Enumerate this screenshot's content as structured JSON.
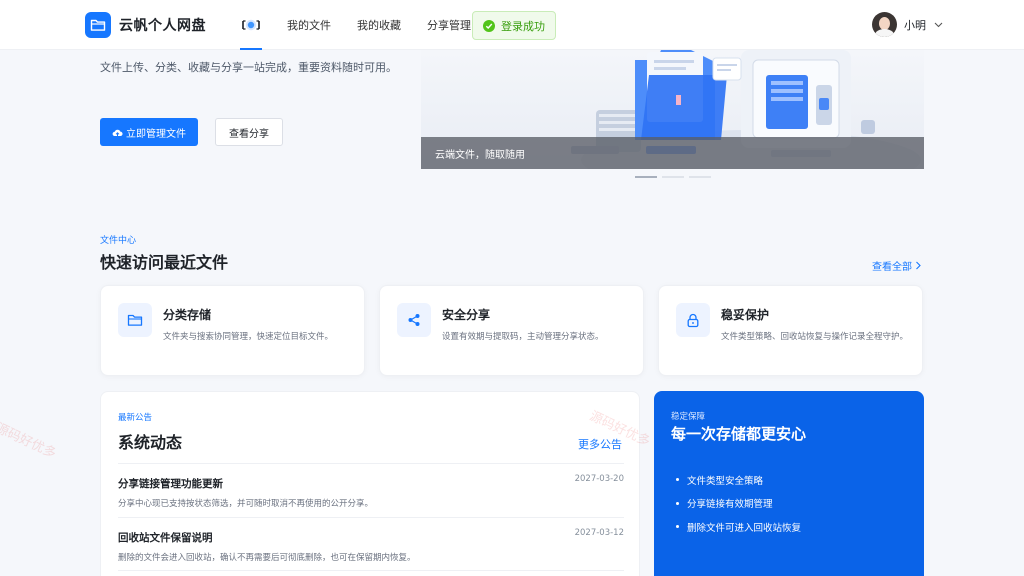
{
  "header": {
    "logo_text": "云帆个人网盘",
    "nav": [
      {
        "label": "我的文件"
      },
      {
        "label": "我的收藏"
      },
      {
        "label": "分享管理"
      }
    ],
    "toast": "登录成功",
    "user_name": "小明"
  },
  "hero": {
    "description": "文件上传、分类、收藏与分享一站完成，重要资料随时可用。",
    "primary_button": "立即管理文件",
    "secondary_button": "查看分享",
    "banner_caption": "云端文件，随取随用",
    "carousel": {
      "count": 3,
      "active_index": 0
    }
  },
  "recent": {
    "tag": "文件中心",
    "title": "快速访问最近文件",
    "view_all": "查看全部",
    "cards": [
      {
        "icon": "folder-icon",
        "title": "分类存储",
        "desc": "文件夹与搜索协同管理，快速定位目标文件。"
      },
      {
        "icon": "share-icon",
        "title": "安全分享",
        "desc": "设置有效期与提取码，主动管理分享状态。"
      },
      {
        "icon": "lock-icon",
        "title": "稳妥保护",
        "desc": "文件类型策略、回收站恢复与操作记录全程守护。"
      }
    ]
  },
  "announcements": {
    "tag": "最新公告",
    "title": "系统动态",
    "more": "更多公告",
    "items": [
      {
        "title": "分享链接管理功能更新",
        "desc": "分享中心现已支持按状态筛选，并可随时取消不再使用的公开分享。",
        "date": "2027-03-20"
      },
      {
        "title": "回收站文件保留说明",
        "desc": "删除的文件会进入回收站，确认不再需要后可彻底删除，也可在保留期内恢复。",
        "date": "2027-03-12"
      }
    ]
  },
  "feature": {
    "tag": "稳定保障",
    "title": "每一次存储都更安心",
    "items": [
      "文件类型安全策略",
      "分享链接有效期管理",
      "删除文件可进入回收站恢复"
    ]
  },
  "watermark": "源码好优多",
  "colors": {
    "primary": "#1677ff",
    "feature_bg": "#0a63e8",
    "success": "#52c41a"
  }
}
